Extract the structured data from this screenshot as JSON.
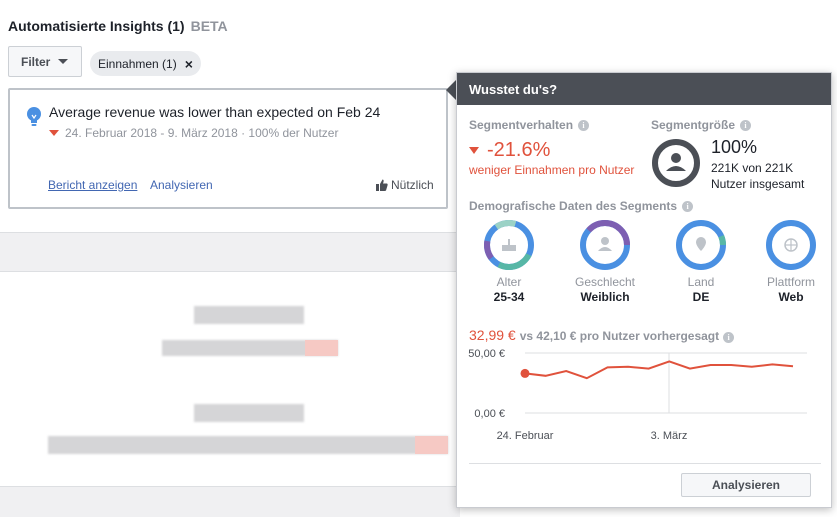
{
  "header": {
    "title": "Automatisierte Insights (1)",
    "beta": "BETA"
  },
  "filter": {
    "label": "Filter",
    "chip_label": "Einnahmen (1)",
    "chip_close": "×"
  },
  "insight": {
    "title": "Average revenue was lower than expected on Feb 24",
    "meta": "24. Februar 2018 - 9. März 2018 · 100% der Nutzer",
    "link_report": "Bericht anzeigen",
    "link_analyze": "Analysieren",
    "useful": "Nützlich"
  },
  "popover": {
    "title": "Wusstet du's?",
    "segment_behavior": {
      "label": "Segmentverhalten",
      "value": "-21.6%",
      "desc": "weniger Einnahmen pro Nutzer"
    },
    "segment_size": {
      "label": "Segmentgröße",
      "value": "100%",
      "count": "221K von 221K",
      "sub": "Nutzer insgesamt"
    },
    "demographics": {
      "label": "Demografische Daten des Segments",
      "items": [
        {
          "label": "Alter",
          "value": "25-34",
          "icon": "age-icon"
        },
        {
          "label": "Geschlecht",
          "value": "Weiblich",
          "icon": "person-icon"
        },
        {
          "label": "Land",
          "value": "DE",
          "icon": "location-pin-icon"
        },
        {
          "label": "Plattform",
          "value": "Web",
          "icon": "globe-icon"
        }
      ]
    },
    "chart_heading": {
      "actual": "32,99 €",
      "text": "vs 42,10 € pro Nutzer vorhergesagt"
    },
    "analyze_button": "Analysieren"
  },
  "chart_data": {
    "type": "line",
    "title": "",
    "xlabel": "",
    "ylabel": "",
    "x_tick_labels": [
      "24. Februar",
      "3. März"
    ],
    "y_tick_labels": [
      "50,00 €",
      "0,00 €"
    ],
    "ylim": [
      0,
      50
    ],
    "x": [
      "24. Februar",
      "25. Februar",
      "26. Februar",
      "27. Februar",
      "28. Februar",
      "1. März",
      "2. März",
      "3. März",
      "4. März",
      "5. März",
      "6. März",
      "7. März",
      "8. März",
      "9. März"
    ],
    "series": [
      {
        "values": [
          33.0,
          31.0,
          35.0,
          29.0,
          38.0,
          38.5,
          37.0,
          43.0,
          37.0,
          40.0,
          40.0,
          38.5,
          40.5,
          39.0
        ]
      }
    ],
    "highlight_point": 0,
    "colors": {
      "line": "#e0523c",
      "ring": "#4a90e2"
    }
  }
}
